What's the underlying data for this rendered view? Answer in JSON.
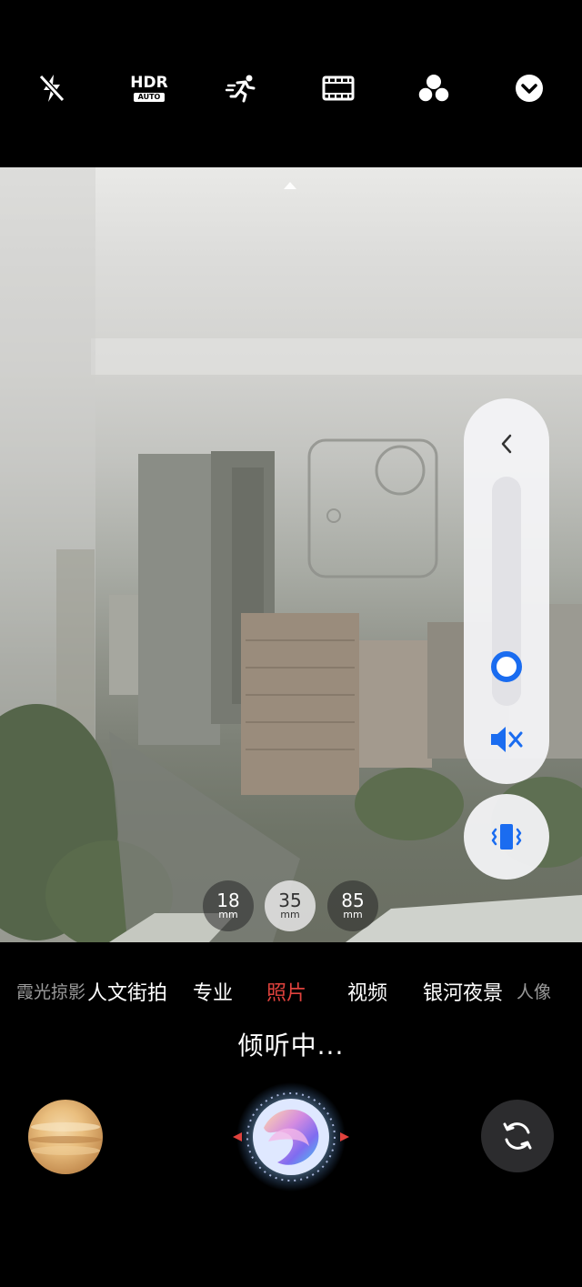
{
  "top_toolbar": {
    "icons": [
      "flash-off-icon",
      "hdr-auto-icon",
      "motion-icon",
      "aspect-ratio-icon",
      "filter-icon",
      "more-dropdown-icon"
    ],
    "hdr_label": "HDR",
    "hdr_sublabel": "AUTO"
  },
  "volume_panel": {
    "level_fraction": 0.12,
    "accent_color": "#1a6cf0"
  },
  "zoom": {
    "unit": "mm",
    "options": [
      {
        "value": "18",
        "active": false
      },
      {
        "value": "35",
        "active": true
      },
      {
        "value": "85",
        "active": false
      }
    ]
  },
  "modes": {
    "items": [
      "霞光掠影",
      "人文街拍",
      "专业",
      "照片",
      "视频",
      "银河夜景",
      "人像"
    ],
    "active": "照片",
    "active_color": "#e0423d"
  },
  "status": {
    "listening_text": "倾听中..."
  },
  "bottom": {
    "gallery_thumbnail": "gallery-thumbnail",
    "shutter": "voice-shutter-button",
    "switch_camera": "switch-camera-icon"
  }
}
